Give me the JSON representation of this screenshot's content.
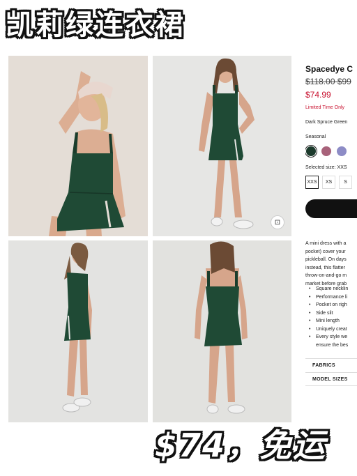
{
  "overlay": {
    "headline": "凯莉绿连衣裙",
    "promo": "$74，免运"
  },
  "product": {
    "name": "Spacedye C",
    "price_original": "$118.00 $99",
    "price_sale": "$74.99",
    "limited_time": "Limited Time Only",
    "color_name": "Dark Spruce Green",
    "seasonal_label": "Seasonal",
    "swatches": [
      {
        "name": "dark-spruce-green",
        "color": "#1c3a2c",
        "selected": true
      },
      {
        "name": "mauve",
        "color": "#a8627a",
        "selected": false
      },
      {
        "name": "lavender",
        "color": "#8d8cc6",
        "selected": false
      }
    ],
    "selected_size_label": "Selected size: XXS",
    "sizes": [
      "XXS",
      "XS",
      "S"
    ],
    "description_lines": [
      "A mini dress with a",
      "pocket) cover your",
      "pickleball. On days",
      "instead, this flatter",
      "throw-on-and-go m",
      "market before grab"
    ],
    "features": [
      "Square necklin",
      "Performance li",
      "Pocket on righ",
      "Side slit",
      "Mini length",
      "Uniquely creat",
      "Every style we"
    ],
    "feature_continuation": "ensure the bes",
    "accordions": [
      "FABRICS",
      "MODEL SIZES"
    ]
  },
  "colors": {
    "dress": "#1f4a35",
    "sale_red": "#c8102e"
  }
}
